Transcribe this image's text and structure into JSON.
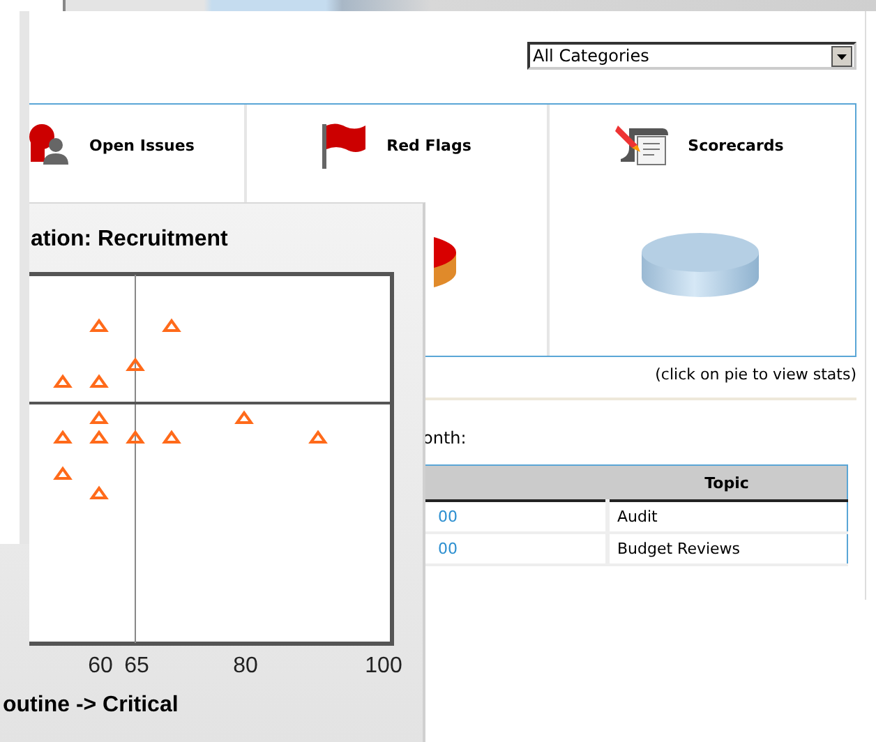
{
  "category_filter": {
    "value": "All Categories"
  },
  "panels": [
    {
      "kind": "open_issues",
      "label": "Open Issues"
    },
    {
      "kind": "red_flags",
      "label": "Red Flags"
    },
    {
      "kind": "scorecards",
      "label": "Scorecards"
    }
  ],
  "pie_hint": "(click on pie to view stats)",
  "table_intro": "onth:",
  "table": {
    "columns": [
      "Topic"
    ],
    "rows": [
      {
        "column_1": "00",
        "topic": "Audit"
      },
      {
        "column_1": "00",
        "topic": "Budget Reviews"
      }
    ]
  },
  "chart_window": {
    "title": "ation: Recruitment",
    "xticks": [
      "60",
      "65",
      "80",
      "100"
    ],
    "xlabel": "outine -> Critical"
  }
}
